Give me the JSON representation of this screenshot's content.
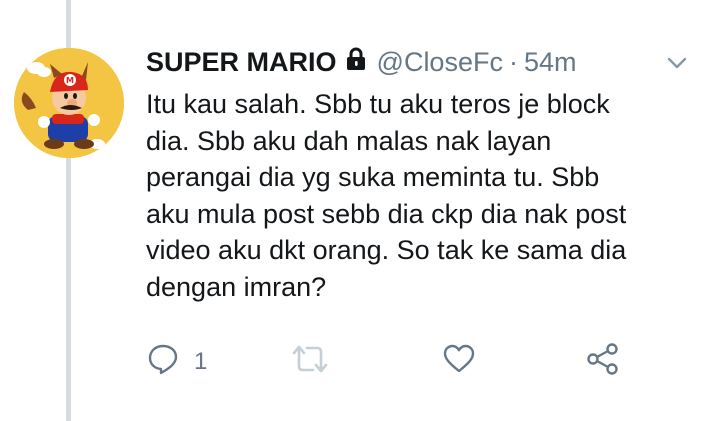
{
  "tweet": {
    "author": {
      "display_name": "SUPER MARIO",
      "handle": "@CloseFc",
      "protected": true
    },
    "separator": "·",
    "time": "54m",
    "text_lines": [
      "Itu kau salah. Sbb tu aku teros je block",
      "dia. Sbb aku dah malas nak layan",
      "perangai dia yg suka meminta tu. Sbb",
      "aku mula post sebb dia ckp dia nak post",
      "video aku dkt orang. So tak ke sama dia",
      "dengan imran?"
    ],
    "actions": {
      "reply_count": "1"
    }
  },
  "colors": {
    "text": "#14171a",
    "muted": "#657786",
    "thread_line": "#d6dbe0",
    "avatar_bg": "#f4c542"
  },
  "icons": [
    "lock-icon",
    "chevron-down-icon",
    "reply-icon",
    "retweet-icon",
    "like-icon",
    "share-icon"
  ]
}
